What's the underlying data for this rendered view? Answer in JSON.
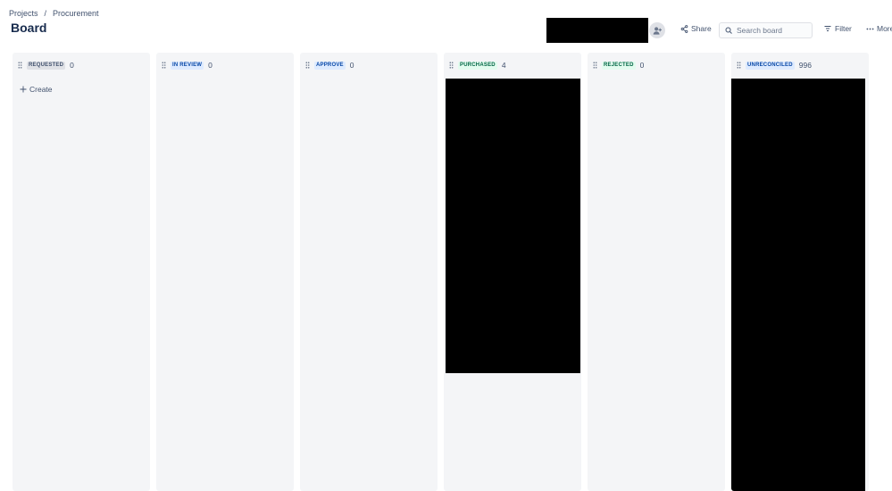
{
  "breadcrumb": {
    "items": [
      "Projects",
      "Procurement"
    ],
    "separator": "/"
  },
  "page": {
    "title": "Board"
  },
  "toolbar": {
    "share_label": "Share",
    "search_placeholder": "Search board",
    "filter_label": "Filter",
    "more_label": "More"
  },
  "columns": [
    {
      "label": "REQUESTED",
      "count": "0",
      "style": "default"
    },
    {
      "label": "IN REVIEW",
      "count": "0",
      "style": "blue"
    },
    {
      "label": "APPROVE",
      "count": "0",
      "style": "blue"
    },
    {
      "label": "PURCHASED",
      "count": "4",
      "style": "green"
    },
    {
      "label": "REJECTED",
      "count": "0",
      "style": "green"
    },
    {
      "label": "UNRECONCILED",
      "count": "996",
      "style": "blue"
    }
  ],
  "create_label": "Create",
  "colors": {
    "lozenge_default_bg": "#dfe1e6",
    "lozenge_blue_bg": "#deebff",
    "lozenge_green_bg": "#e3fcef",
    "column_bg": "#f4f5f7"
  },
  "icons": {
    "drag": "drag-handle-icon",
    "share": "share-icon",
    "search": "search-icon",
    "filter": "filter-icon",
    "more": "more-icon",
    "create": "plus-icon",
    "avatar": "add-people-icon"
  }
}
